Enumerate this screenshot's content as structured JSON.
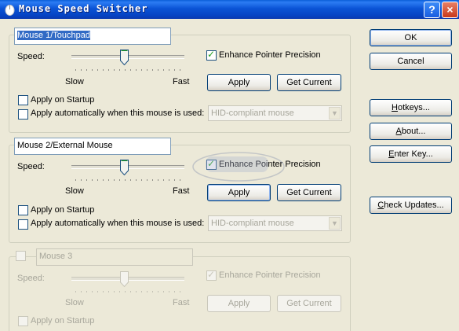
{
  "window": {
    "title": "Mouse Speed Switcher",
    "help_label": "?",
    "close_label": "×"
  },
  "labels": {
    "speed": "Speed:",
    "slow": "Slow",
    "fast": "Fast",
    "enhance": "Enhance Pointer Precision",
    "apply": "Apply",
    "get_current": "Get Current",
    "apply_startup": "Apply on Startup",
    "apply_auto": "Apply automatically when this mouse is used:"
  },
  "mice": [
    {
      "name": "Mouse 1/Touchpad",
      "name_selected": true,
      "enabled": true,
      "speed_level": 0.5,
      "enhance_checked": true,
      "startup_checked": false,
      "auto_checked": false,
      "device": "HID-compliant mouse"
    },
    {
      "name": "Mouse 2/External Mouse",
      "name_selected": false,
      "enabled": true,
      "speed_level": 0.5,
      "enhance_checked": true,
      "startup_checked": false,
      "auto_checked": false,
      "device": "HID-compliant mouse"
    },
    {
      "name": "Mouse 3",
      "name_selected": false,
      "enabled": false,
      "speed_level": 0.5,
      "enhance_checked": true,
      "startup_checked": false,
      "auto_checked": false,
      "device": ""
    }
  ],
  "side_buttons": {
    "ok": "OK",
    "cancel": "Cancel",
    "hotkeys_u": "H",
    "hotkeys_rest": "otkeys...",
    "about_u": "A",
    "about_rest": "bout...",
    "enter_key_u": "E",
    "enter_key_rest": "nter Key...",
    "check_updates_u": "C",
    "check_updates_rest": "heck Updates..."
  },
  "colors": {
    "title_bar": "#0a54d6",
    "face": "#ece9d8",
    "selection": "#316ac5",
    "check": "#21a121",
    "disabled_text": "#a7a69b"
  },
  "icons": [
    "mouse-icon",
    "help-icon",
    "close-icon",
    "slider-thumb-icon",
    "combo-arrow-icon"
  ]
}
